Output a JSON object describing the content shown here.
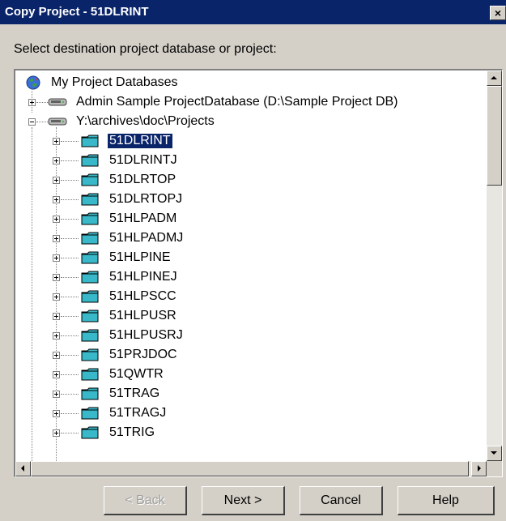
{
  "window": {
    "title": "Copy Project - 51DLRINT",
    "close_label": "×"
  },
  "prompt": "Select destination project database or project:",
  "tree": {
    "root": "My Project Databases",
    "databases": [
      {
        "label": "Admin Sample ProjectDatabase (D:\\Sample Project DB)",
        "expanded": false
      },
      {
        "label": "Y:\\archives\\doc\\Projects",
        "expanded": true
      }
    ],
    "projects": [
      "51DLRINT",
      "51DLRINTJ",
      "51DLRTOP",
      "51DLRTOPJ",
      "51HLPADM",
      "51HLPADMJ",
      "51HLPINE",
      "51HLPINEJ",
      "51HLPSCC",
      "51HLPUSR",
      "51HLPUSRJ",
      "51PRJDOC",
      "51QWTR",
      "51TRAG",
      "51TRAGJ",
      "51TRIG"
    ],
    "selected_project": "51DLRINT"
  },
  "buttons": {
    "back": "< Back",
    "next": "Next >",
    "cancel": "Cancel",
    "help": "Help"
  },
  "colors": {
    "titlebar": "#0a246a",
    "dialog": "#d4d0c8",
    "folder": "#38b8c8",
    "selection": "#0a246a"
  }
}
